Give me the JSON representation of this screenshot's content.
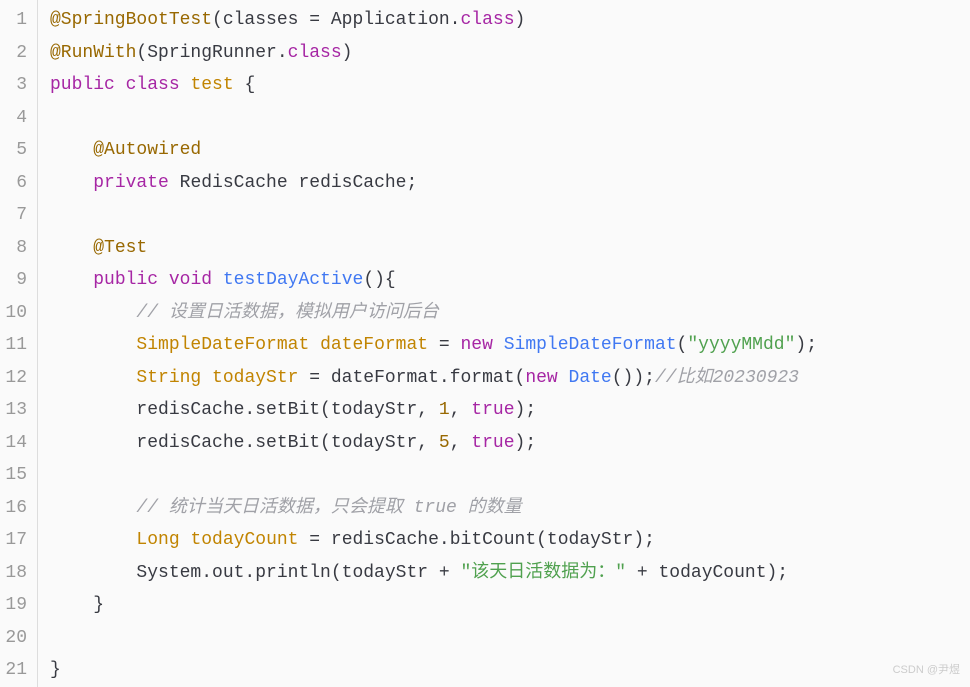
{
  "line_numbers": [
    "1",
    "2",
    "3",
    "4",
    "5",
    "6",
    "7",
    "8",
    "9",
    "10",
    "11",
    "12",
    "13",
    "14",
    "15",
    "16",
    "17",
    "18",
    "19",
    "20",
    "21"
  ],
  "code_lines": [
    {
      "tokens": [
        {
          "cls": "annotation",
          "t": "@SpringBootTest"
        },
        {
          "cls": "plain",
          "t": "(classes = Application."
        },
        {
          "cls": "keyword",
          "t": "class"
        },
        {
          "cls": "plain",
          "t": ")"
        }
      ]
    },
    {
      "tokens": [
        {
          "cls": "annotation",
          "t": "@RunWith"
        },
        {
          "cls": "plain",
          "t": "(SpringRunner."
        },
        {
          "cls": "keyword",
          "t": "class"
        },
        {
          "cls": "plain",
          "t": ")"
        }
      ]
    },
    {
      "tokens": [
        {
          "cls": "keyword",
          "t": "public"
        },
        {
          "cls": "plain",
          "t": " "
        },
        {
          "cls": "keyword",
          "t": "class"
        },
        {
          "cls": "plain",
          "t": " "
        },
        {
          "cls": "classname",
          "t": "test"
        },
        {
          "cls": "plain",
          "t": " {"
        }
      ]
    },
    {
      "tokens": [
        {
          "cls": "plain",
          "t": ""
        }
      ]
    },
    {
      "tokens": [
        {
          "cls": "plain",
          "t": "    "
        },
        {
          "cls": "annotation",
          "t": "@Autowired"
        }
      ]
    },
    {
      "tokens": [
        {
          "cls": "plain",
          "t": "    "
        },
        {
          "cls": "keyword",
          "t": "private"
        },
        {
          "cls": "plain",
          "t": " RedisCache redisCache;"
        }
      ]
    },
    {
      "tokens": [
        {
          "cls": "plain",
          "t": ""
        }
      ]
    },
    {
      "tokens": [
        {
          "cls": "plain",
          "t": "    "
        },
        {
          "cls": "annotation",
          "t": "@Test"
        }
      ]
    },
    {
      "tokens": [
        {
          "cls": "plain",
          "t": "    "
        },
        {
          "cls": "keyword",
          "t": "public"
        },
        {
          "cls": "plain",
          "t": " "
        },
        {
          "cls": "keyword",
          "t": "void"
        },
        {
          "cls": "plain",
          "t": " "
        },
        {
          "cls": "method-name",
          "t": "testDayActive"
        },
        {
          "cls": "plain",
          "t": "(){"
        }
      ]
    },
    {
      "tokens": [
        {
          "cls": "plain",
          "t": "        "
        },
        {
          "cls": "comment",
          "t": "// 设置日活数据，模拟用户访问后台"
        }
      ]
    },
    {
      "tokens": [
        {
          "cls": "plain",
          "t": "        "
        },
        {
          "cls": "classname",
          "t": "SimpleDateFormat"
        },
        {
          "cls": "plain",
          "t": " "
        },
        {
          "cls": "classname",
          "t": "dateFormat"
        },
        {
          "cls": "plain",
          "t": " = "
        },
        {
          "cls": "keyword",
          "t": "new"
        },
        {
          "cls": "plain",
          "t": " "
        },
        {
          "cls": "method-name",
          "t": "SimpleDateFormat"
        },
        {
          "cls": "plain",
          "t": "("
        },
        {
          "cls": "string",
          "t": "\"yyyyMMdd\""
        },
        {
          "cls": "plain",
          "t": ");"
        }
      ]
    },
    {
      "tokens": [
        {
          "cls": "plain",
          "t": "        "
        },
        {
          "cls": "classname",
          "t": "String"
        },
        {
          "cls": "plain",
          "t": " "
        },
        {
          "cls": "classname",
          "t": "todayStr"
        },
        {
          "cls": "plain",
          "t": " = dateFormat.format("
        },
        {
          "cls": "keyword",
          "t": "new"
        },
        {
          "cls": "plain",
          "t": " "
        },
        {
          "cls": "method-name",
          "t": "Date"
        },
        {
          "cls": "plain",
          "t": "());"
        },
        {
          "cls": "comment",
          "t": "//比如20230923"
        }
      ]
    },
    {
      "tokens": [
        {
          "cls": "plain",
          "t": "        redisCache.setBit(todayStr, "
        },
        {
          "cls": "number",
          "t": "1"
        },
        {
          "cls": "plain",
          "t": ", "
        },
        {
          "cls": "bool",
          "t": "true"
        },
        {
          "cls": "plain",
          "t": ");"
        }
      ]
    },
    {
      "tokens": [
        {
          "cls": "plain",
          "t": "        redisCache.setBit(todayStr, "
        },
        {
          "cls": "number",
          "t": "5"
        },
        {
          "cls": "plain",
          "t": ", "
        },
        {
          "cls": "bool",
          "t": "true"
        },
        {
          "cls": "plain",
          "t": ");"
        }
      ]
    },
    {
      "tokens": [
        {
          "cls": "plain",
          "t": ""
        }
      ]
    },
    {
      "tokens": [
        {
          "cls": "plain",
          "t": "        "
        },
        {
          "cls": "comment",
          "t": "// 统计当天日活数据，只会提取 true 的数量"
        }
      ]
    },
    {
      "tokens": [
        {
          "cls": "plain",
          "t": "        "
        },
        {
          "cls": "classname",
          "t": "Long"
        },
        {
          "cls": "plain",
          "t": " "
        },
        {
          "cls": "classname",
          "t": "todayCount"
        },
        {
          "cls": "plain",
          "t": " = redisCache.bitCount(todayStr);"
        }
      ]
    },
    {
      "tokens": [
        {
          "cls": "plain",
          "t": "        System.out.println(todayStr + "
        },
        {
          "cls": "string",
          "t": "\"该天日活数据为：\""
        },
        {
          "cls": "plain",
          "t": " + todayCount);"
        }
      ]
    },
    {
      "tokens": [
        {
          "cls": "plain",
          "t": "    }"
        }
      ]
    },
    {
      "tokens": [
        {
          "cls": "plain",
          "t": ""
        }
      ]
    },
    {
      "tokens": [
        {
          "cls": "plain",
          "t": "}"
        }
      ]
    }
  ],
  "watermark": "CSDN @尹煜"
}
